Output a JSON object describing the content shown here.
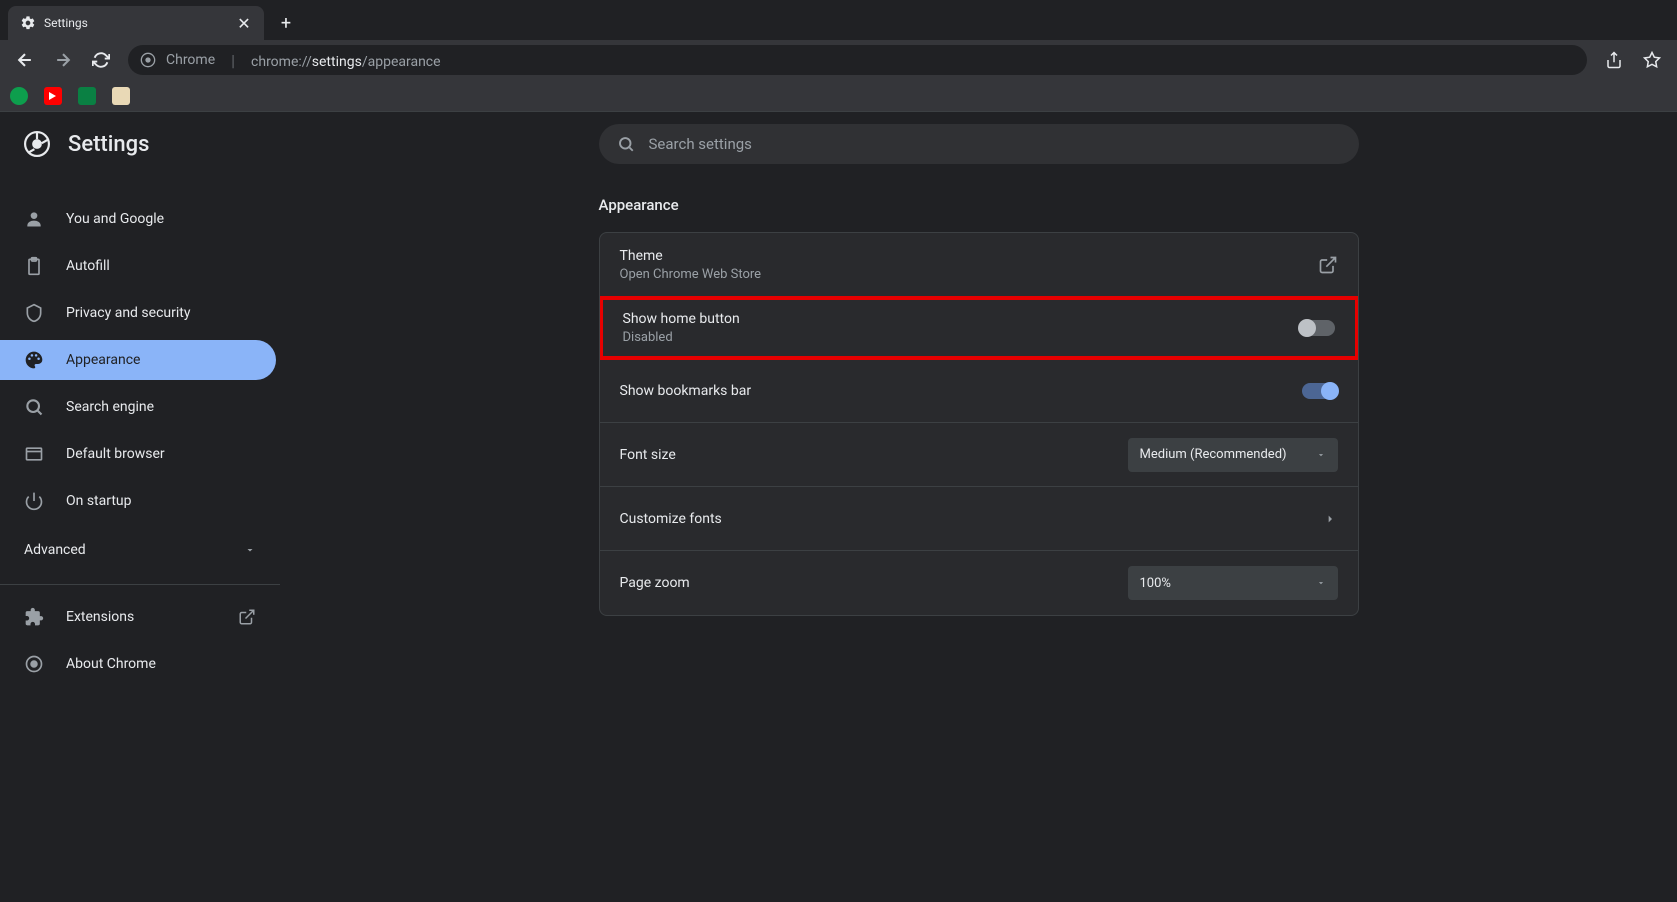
{
  "browser": {
    "tab_title": "Settings",
    "url_prefix": "Chrome",
    "url_path_dim1": "chrome://",
    "url_path_bold": "settings",
    "url_path_dim2": "/appearance"
  },
  "header": {
    "title": "Settings",
    "search_placeholder": "Search settings"
  },
  "sidebar": {
    "items": [
      {
        "label": "You and Google"
      },
      {
        "label": "Autofill"
      },
      {
        "label": "Privacy and security"
      },
      {
        "label": "Appearance"
      },
      {
        "label": "Search engine"
      },
      {
        "label": "Default browser"
      },
      {
        "label": "On startup"
      }
    ],
    "advanced": "Advanced",
    "extensions": "Extensions",
    "about": "About Chrome"
  },
  "content": {
    "section_title": "Appearance",
    "theme": {
      "primary": "Theme",
      "secondary": "Open Chrome Web Store"
    },
    "home_button": {
      "primary": "Show home button",
      "secondary": "Disabled"
    },
    "bookmarks_bar": {
      "primary": "Show bookmarks bar"
    },
    "font_size": {
      "primary": "Font size",
      "value": "Medium (Recommended)"
    },
    "customize_fonts": {
      "primary": "Customize fonts"
    },
    "page_zoom": {
      "primary": "Page zoom",
      "value": "100%"
    }
  }
}
